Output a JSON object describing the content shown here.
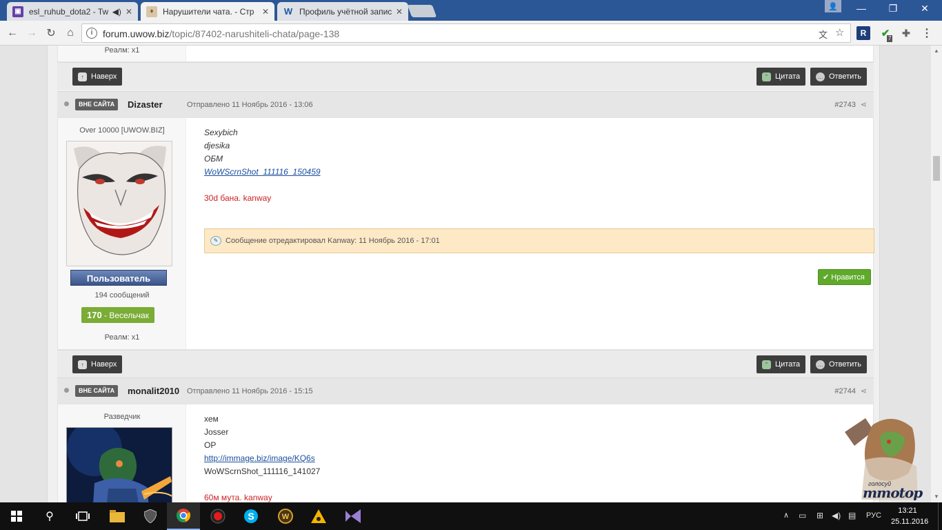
{
  "browser": {
    "tabs": [
      {
        "title": "esl_ruhub_dota2 - Tw",
        "icon": "twitch-icon"
      },
      {
        "title": "Нарушители чата. - Стр",
        "icon": "uwow-icon"
      },
      {
        "title": "Профиль учётной запис",
        "icon": "w-icon"
      }
    ],
    "url_host": "forum.uwow.biz",
    "url_path": "/topic/87402-narushiteli-chata/page-138",
    "ext_badge": "7"
  },
  "top_strip": {
    "realm": "Реалм: x1"
  },
  "buttons": {
    "top": "Наверх",
    "quote": "Цитата",
    "reply": "Ответить",
    "like": "Нравится"
  },
  "posts": [
    {
      "status": "ВНЕ САЙТА",
      "author": "Dizaster",
      "sent": "Отправлено 11 Ноябрь 2016 - 13:06",
      "number": "#2743",
      "rank": "Over 10000 [UWOW.BIZ]",
      "group": "Пользователь",
      "posts_count": "194 сообщений",
      "rep_value": "170",
      "rep_label": "- Весельчак",
      "realm": "Реалм: x1",
      "lines": [
        "Sexybich",
        "djesika",
        "ОБМ"
      ],
      "link": "WoWScrnShot_111116_150459",
      "punishment": "30d бана. kanway",
      "edit_note": "Сообщение отредактировал Kanway: 11 Ноябрь 2016 - 17:01"
    },
    {
      "status": "ВНЕ САЙТА",
      "author": "monalit2010",
      "sent": "Отправлено 11 Ноябрь 2016 - 15:15",
      "number": "#2744",
      "rank": "Разведчик",
      "lines": [
        "хем",
        "Josser",
        "OP"
      ],
      "link": "http://immage.biz/image/KQ6s",
      "extra": "WoWScrnShot_111116_141027",
      "punishment": "60м мута. kanway"
    }
  ],
  "mmotop": {
    "vote": "голосуй",
    "logo": "mmotop"
  },
  "taskbar": {
    "lang": "РУС",
    "time": "13:21",
    "date": "25.11.2016"
  }
}
